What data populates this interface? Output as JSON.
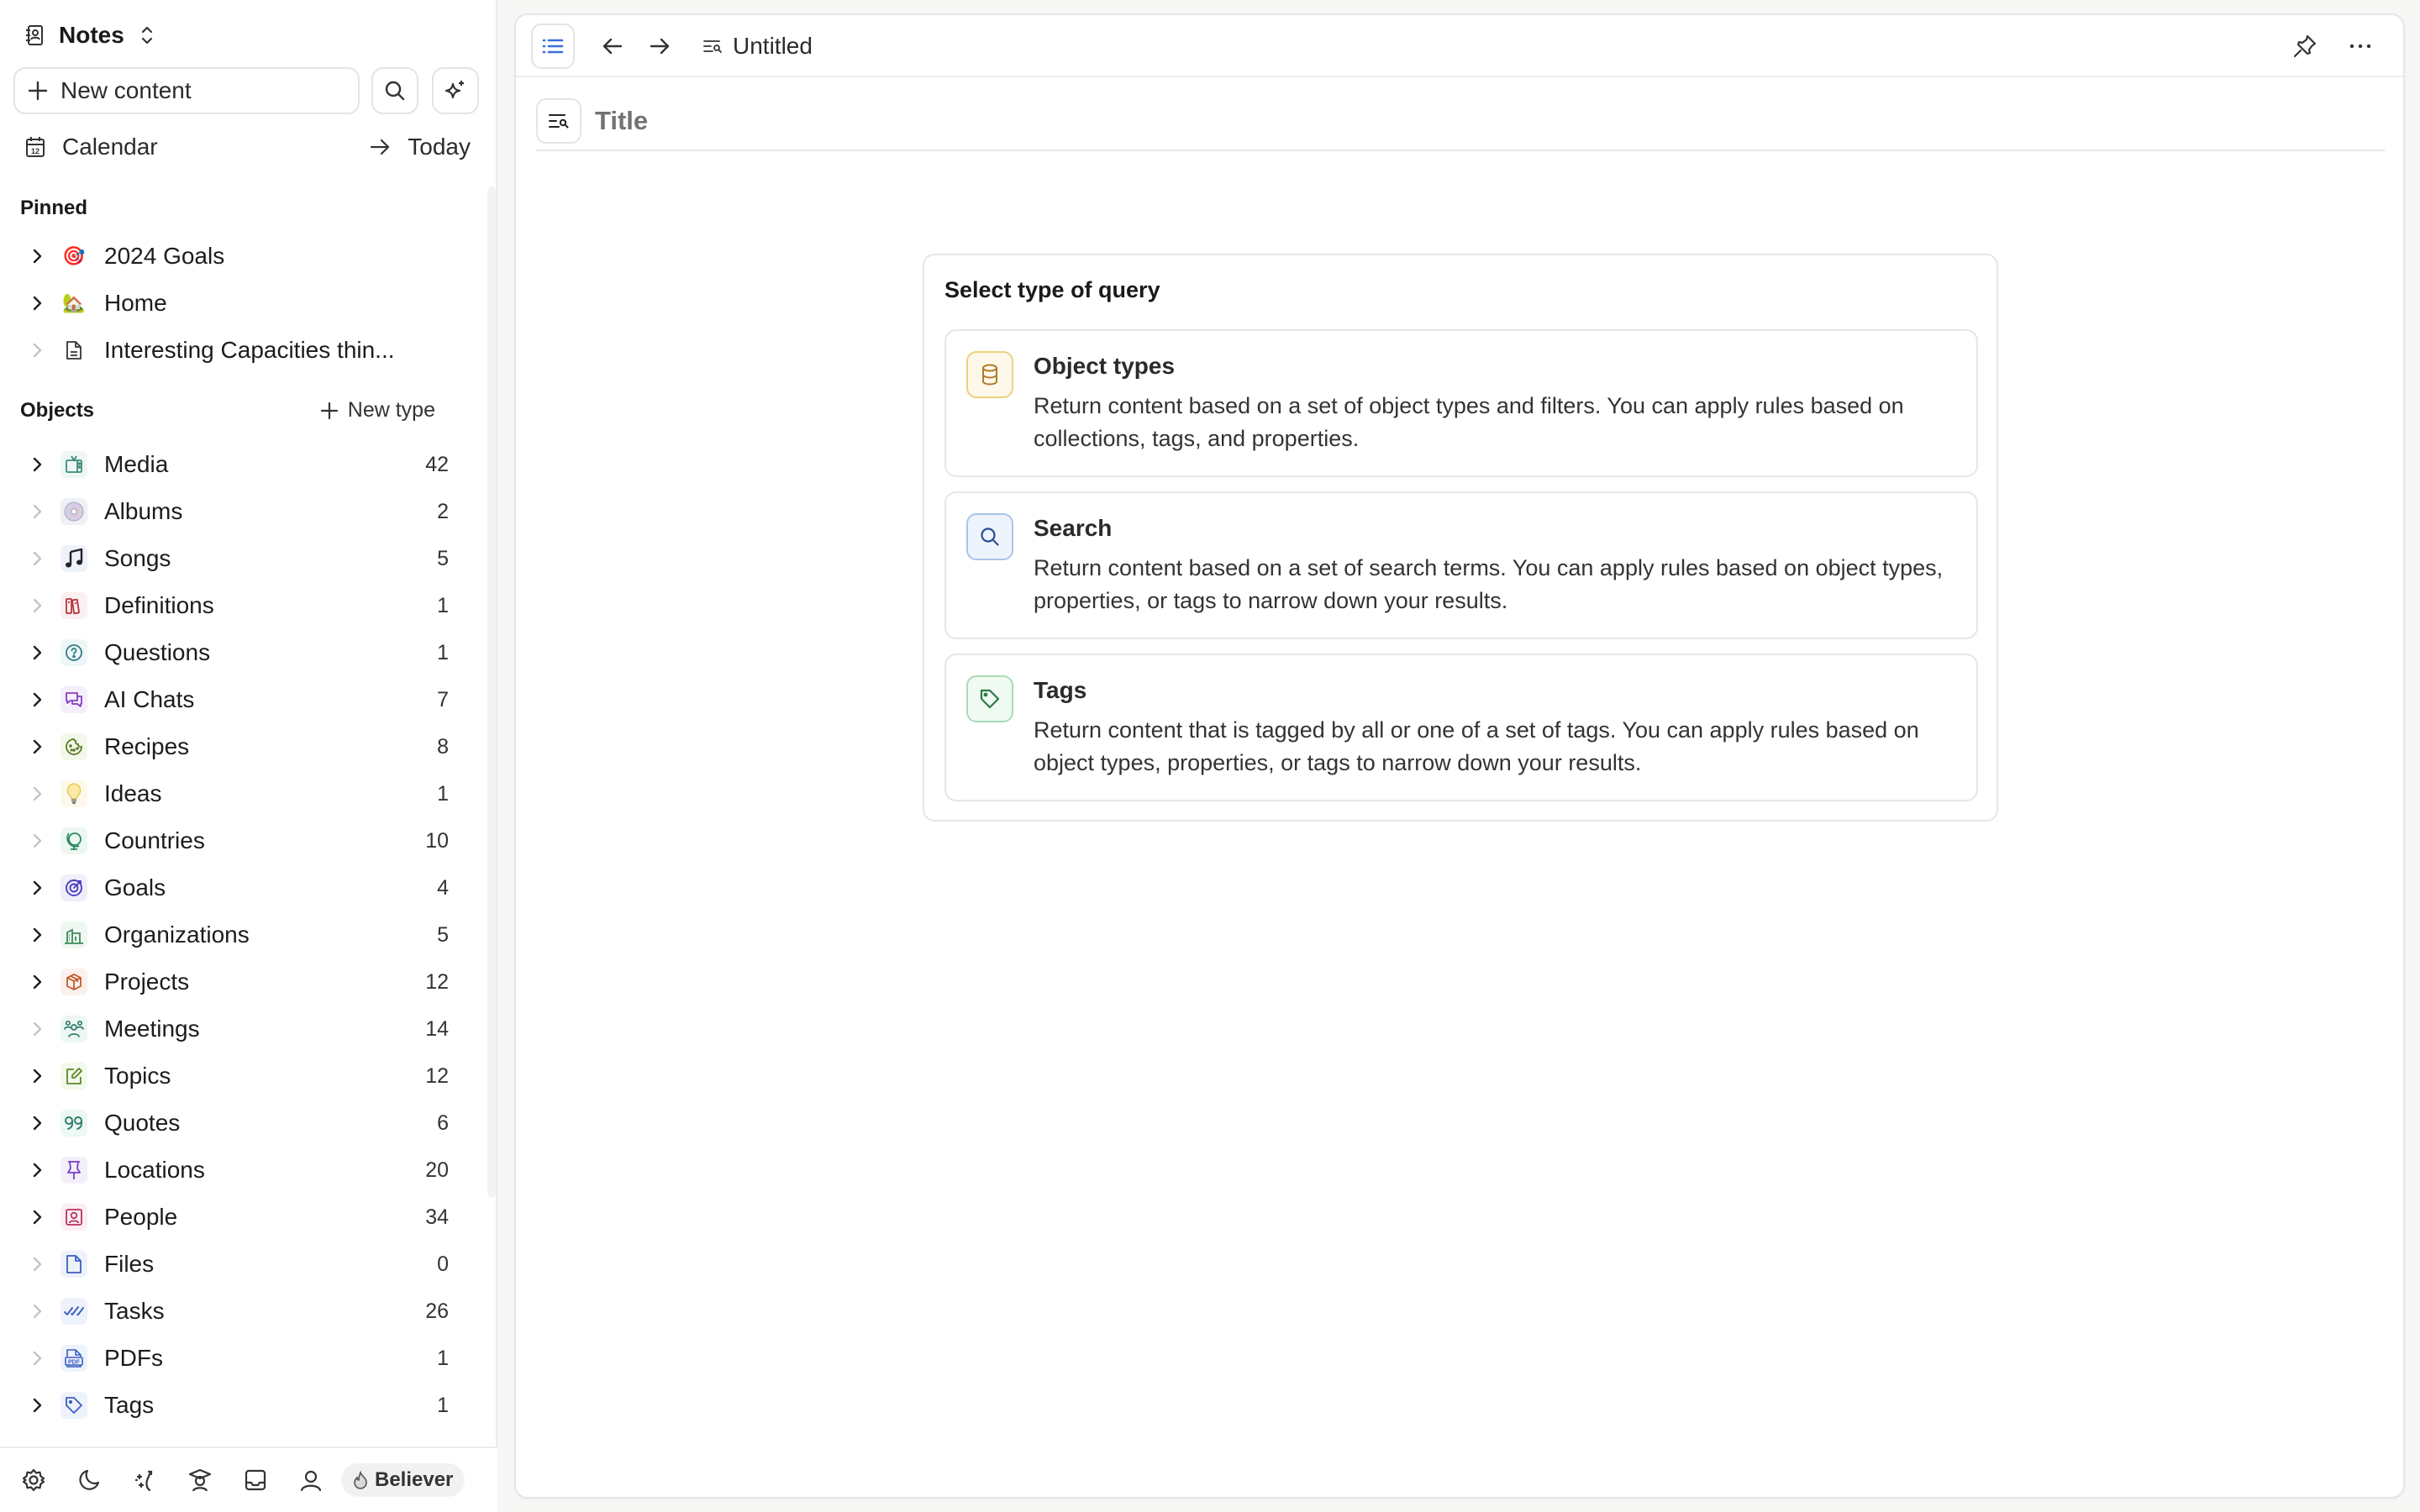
{
  "sidebar": {
    "space": {
      "name": "Notes",
      "icon": "contact-book-icon",
      "switcher_icon": "chevron-up-down-icon"
    },
    "new_content_label": "New content",
    "search_icon": "search-icon",
    "ai_icon": "sparkle-icon",
    "calendar_label": "Calendar",
    "today_label": "Today",
    "pinned_label": "Pinned",
    "pinned": [
      {
        "label": "2024 Goals",
        "icon": "🎯",
        "expandable": true
      },
      {
        "label": "Home",
        "icon": "🏡",
        "expandable": true
      },
      {
        "label": "Interesting Capacities thin...",
        "icon": "document-icon",
        "expandable": false
      }
    ],
    "objects_label": "Objects",
    "new_type_label": "New type",
    "objects": [
      {
        "label": "Media",
        "count": "42",
        "icon": "tv-icon",
        "color": "#3d8a7a",
        "bg": "#eef7f4",
        "expandable": true
      },
      {
        "label": "Albums",
        "count": "2",
        "icon": "cd-icon",
        "color": "#9aa0b0",
        "bg": "#eff1f7",
        "expandable": false
      },
      {
        "label": "Songs",
        "count": "5",
        "icon": "music-note-icon",
        "color": "#222222",
        "bg": "#eef2fa",
        "expandable": false
      },
      {
        "label": "Definitions",
        "count": "1",
        "icon": "books-icon",
        "color": "#b8323c",
        "bg": "#fbeff0",
        "expandable": false
      },
      {
        "label": "Questions",
        "count": "1",
        "icon": "question-icon",
        "color": "#2f7d86",
        "bg": "#eef7f8",
        "expandable": true
      },
      {
        "label": "AI Chats",
        "count": "7",
        "icon": "chat-icon",
        "color": "#8a3fc2",
        "bg": "#f4effb",
        "expandable": true
      },
      {
        "label": "Recipes",
        "count": "8",
        "icon": "cookie-icon",
        "color": "#5a7a2a",
        "bg": "#f3f9ea",
        "expandable": true
      },
      {
        "label": "Ideas",
        "count": "1",
        "icon": "lightbulb-icon",
        "color": "#e8c14a",
        "bg": "#fcf9ea",
        "expandable": false
      },
      {
        "label": "Countries",
        "count": "10",
        "icon": "globe-icon",
        "color": "#2e8a5f",
        "bg": "#edf7f1",
        "expandable": false
      },
      {
        "label": "Goals",
        "count": "4",
        "icon": "target-icon",
        "color": "#4a3fc2",
        "bg": "#efeffb",
        "expandable": true
      },
      {
        "label": "Organizations",
        "count": "5",
        "icon": "building-icon",
        "color": "#3d8a5a",
        "bg": "#eef7f1",
        "expandable": true
      },
      {
        "label": "Projects",
        "count": "12",
        "icon": "package-icon",
        "color": "#c2562a",
        "bg": "#fbf1ec",
        "expandable": true
      },
      {
        "label": "Meetings",
        "count": "14",
        "icon": "group-icon",
        "color": "#2f7d6a",
        "bg": "#edf7f4",
        "expandable": false
      },
      {
        "label": "Topics",
        "count": "12",
        "icon": "edit-square-icon",
        "color": "#5a8a2a",
        "bg": "#f3f9ea",
        "expandable": true
      },
      {
        "label": "Quotes",
        "count": "6",
        "icon": "quote-icon",
        "color": "#2f7d6a",
        "bg": "#edf7f4",
        "expandable": true
      },
      {
        "label": "Locations",
        "count": "20",
        "icon": "pushpin-icon",
        "color": "#7a3fc2",
        "bg": "#f3effb",
        "expandable": true
      },
      {
        "label": "People",
        "count": "34",
        "icon": "person-frame-icon",
        "color": "#b8325a",
        "bg": "#fbeff3",
        "expandable": true
      },
      {
        "label": "Files",
        "count": "0",
        "icon": "file-icon",
        "color": "#3a5ec2",
        "bg": "#eef2fb",
        "expandable": false
      },
      {
        "label": "Tasks",
        "count": "26",
        "icon": "double-check-icon",
        "color": "#3a5ec2",
        "bg": "#eef2fb",
        "expandable": false
      },
      {
        "label": "PDFs",
        "count": "1",
        "icon": "pdf-icon",
        "color": "#3a5ec2",
        "bg": "#eef2fb",
        "expandable": false
      },
      {
        "label": "Tags",
        "count": "1",
        "icon": "tag-icon",
        "color": "#3a5ec2",
        "bg": "#eef2fb",
        "expandable": true
      }
    ],
    "footer": {
      "icons": [
        "gear-icon",
        "moon-icon",
        "whats-new-icon",
        "graduation-icon",
        "inbox-icon",
        "user-icon"
      ],
      "badge_label": "Believer",
      "badge_icon": "flame-icon"
    }
  },
  "main": {
    "breadcrumb_title": "Untitled",
    "title_placeholder": "Title",
    "query_heading": "Select type of query",
    "options": [
      {
        "title": "Object types",
        "description": "Return content based on a set of object types and filters. You can apply rules based on collections, tags, and properties.",
        "icon": "database-icon",
        "color": "#b07a2a",
        "bg": "#fdf8ea",
        "border": "#ecd27a"
      },
      {
        "title": "Search",
        "description": "Return content based on a set of search terms. You can apply rules based on object types, properties, or tags to narrow down your results.",
        "icon": "search-icon",
        "color": "#2e4a9a",
        "bg": "#eef4fc",
        "border": "#a9c4ea"
      },
      {
        "title": "Tags",
        "description": "Return content that is tagged by all or one of a set of tags. You can apply rules based on object types, properties, or tags to narrow down your results.",
        "icon": "tag-icon",
        "color": "#2e7a4a",
        "bg": "#effaf2",
        "border": "#a9dcb6"
      }
    ]
  },
  "colors": {
    "accent": "#3a6fd8",
    "border": "#e6e6e6",
    "app_background": "#f7f7f6"
  }
}
